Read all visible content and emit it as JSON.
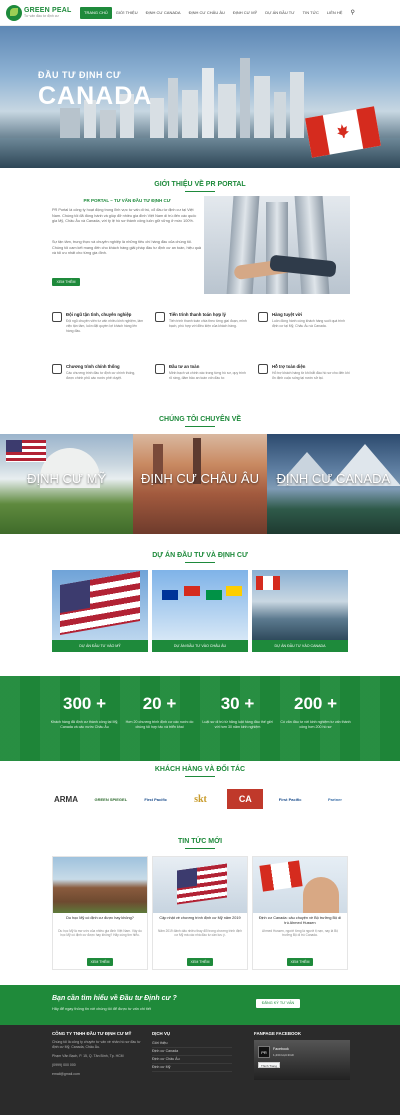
{
  "header": {
    "logo_name": "GREEN PEAL",
    "logo_tagline": "Tư vấn đầu tư định cư",
    "nav": [
      "Trang chủ",
      "Giới thiệu",
      "Định cư Canada",
      "Định cư Châu Âu",
      "Định cư Mỹ",
      "Dự án đầu tư",
      "Tin tức",
      "Liên hệ"
    ],
    "active_index": 0
  },
  "hero": {
    "line1": "ĐẦU TƯ ĐỊNH CƯ",
    "line2": "CANADA",
    "slides": 3,
    "active_slide": 0
  },
  "intro": {
    "title": "GIỚI THIỆU VỀ PR PORTAL",
    "subtitle": "PR PORTAL – TƯ VẤN ĐẦU TƯ ĐỊNH CƯ",
    "p1": "PR Portal là công ty hoạt động trong lĩnh vực tư vấn di trú, cổ đầu tư định cư tại Việt Nam. Chúng tôi đã đồng hành và giúp đỡ nhiều gia đình Việt Nam di trú đến các quốc gia Mỹ, Châu Âu và Canada, với tỷ lệ hồ sơ thành công luôn giữ vững ở mức 100%.",
    "p2": "Sự tận tâm, trung thực và chuyên nghiệp là những tiêu chí hàng đầu của chúng tôi. Chúng tôi cam kết mang đến cho khách hàng giải pháp đầu tư định cư an toàn, hiệu quả và tối ưu nhất cho từng gia đình.",
    "button": "Xem thêm"
  },
  "features": [
    {
      "icon": "team-icon",
      "title": "Đội ngũ tận tình, chuyên nghiệp",
      "desc": "Đội ngũ chuyên viên tư vấn nhiều kinh nghiệm, làm việc tận tâm, luôn đặt quyền lợi khách hàng lên hàng đầu."
    },
    {
      "icon": "chart-icon",
      "title": "Tiến trình thanh toán hợp lý",
      "desc": "Tiến trình thanh toán chia theo từng giai đoạn, minh bạch, phù hợp với điều kiện của khách hàng."
    },
    {
      "icon": "handshake-icon",
      "title": "Hàng tuyệt vời",
      "desc": "Luôn đồng hành cùng khách hàng suốt quá trình định cư tại Mỹ, Châu Âu và Canada."
    },
    {
      "icon": "document-icon",
      "title": "Chương trình chính thống",
      "desc": "Các chương trình đầu tư định cư chính thống, được chính phủ các nước phê duyệt."
    },
    {
      "icon": "shield-icon",
      "title": "Đầu tư an toàn",
      "desc": "Minh bạch và chính xác trong từng hồ sơ, quy trình rõ ràng, đảm bảo an toàn vốn đầu tư."
    },
    {
      "icon": "support-icon",
      "title": "Hỗ trợ toàn diện",
      "desc": "Hỗ trợ khách hàng từ khi bắt đầu hồ sơ cho đến khi ổn định cuộc sống tại nước sở tại."
    }
  ],
  "specialty": {
    "title": "CHÚNG TÔI CHUYÊN VỀ",
    "items": [
      "Định cư Mỹ",
      "Định cư Châu Âu",
      "Định cư Canada"
    ]
  },
  "projects": {
    "title": "DỰ ÁN ĐẦU TƯ VÀ ĐỊNH CƯ",
    "items": [
      "Dự án đầu tư vào Mỹ",
      "Dự án đầu tư vào Châu Âu",
      "Dự án đầu tư vào Canada"
    ]
  },
  "stats": [
    {
      "num": "300 +",
      "desc": "Khách hàng đã định cư thành công tại Mỹ, Canada và các nước Châu Âu"
    },
    {
      "num": "20 +",
      "desc": "Hơn 20 chương trình định cư các nước do chúng tôi hợp tác và triển khai"
    },
    {
      "num": "30 +",
      "desc": "Luật sư di trú từ hãng luật hàng đầu thế giới với hơn 30 năm kinh nghiệm"
    },
    {
      "num": "200 +",
      "desc": "Có văn đầu tư với kinh nghiệm tư vấn thành công hơn 200 hồ sơ"
    }
  ],
  "partners": {
    "title": "KHÁCH HÀNG VÀ ĐỐI TÁC",
    "items": [
      "ARMA",
      "GREEN SPIEGEL",
      "First Pacific",
      "skt",
      "CA",
      "First Pacific",
      "Partner"
    ]
  },
  "news": {
    "title": "TIN TỨC MỚI",
    "items": [
      {
        "title": "Du học Mỹ có định cư được hay không?",
        "desc": "Du học Mỹ là mơ ước của nhiều gia đình Việt Nam. Vậy du học Mỹ có định cư được hay không? Hãy cùng tìm hiểu.",
        "button": "Xem thêm"
      },
      {
        "title": "Cập nhật về chương trình định cư Mỹ năm 2019",
        "desc": "Năm 2019 đánh dấu nhiều thay đổi trong chương trình định cư Mỹ mà các nhà đầu tư cần lưu ý.",
        "button": "Xem thêm"
      },
      {
        "title": "Định cư Canada: câu chuyện về Bộ trưởng Bộ di trú Ahmed Hussen",
        "desc": "Ahmed Hussen, người từng là người tị nạn, nay là Bộ trưởng Bộ di trú Canada.",
        "button": "Xem thêm"
      }
    ]
  },
  "cta": {
    "title": "Bạn cần tìm hiểu về Đầu tư Định cư ?",
    "subtitle": "Hãy để ngay thông tin với chúng tôi để được tư vấn chi tiết",
    "button": "Đăng ký tư vấn"
  },
  "footer": {
    "company_title": "CÔNG TY TNHH ĐẦU TƯ ĐỊNH CƯ MỸ",
    "company_desc": "Chúng tôi là công ty chuyên tư vấn về nhân hồ sơ đầu tư định cư Mỹ, Canada, Châu Âu.",
    "address": "Phạm Văn Bạch, P. 15, Q. Tân Bình, Tp. HCM",
    "phone": "(0999) 000 000",
    "email": "email@gmail.com",
    "services_title": "DỊCH VỤ",
    "services": [
      "Giới thiệu",
      "Định cư Canada",
      "Định cư Châu Âu",
      "Định cư Mỹ"
    ],
    "fanpage_title": "FANPAGE FACEBOOK",
    "fb_logo": "PR",
    "fb_name": "Facebook",
    "fb_likes": "1,234 lượt thích",
    "fb_like": "Thích Trang"
  }
}
